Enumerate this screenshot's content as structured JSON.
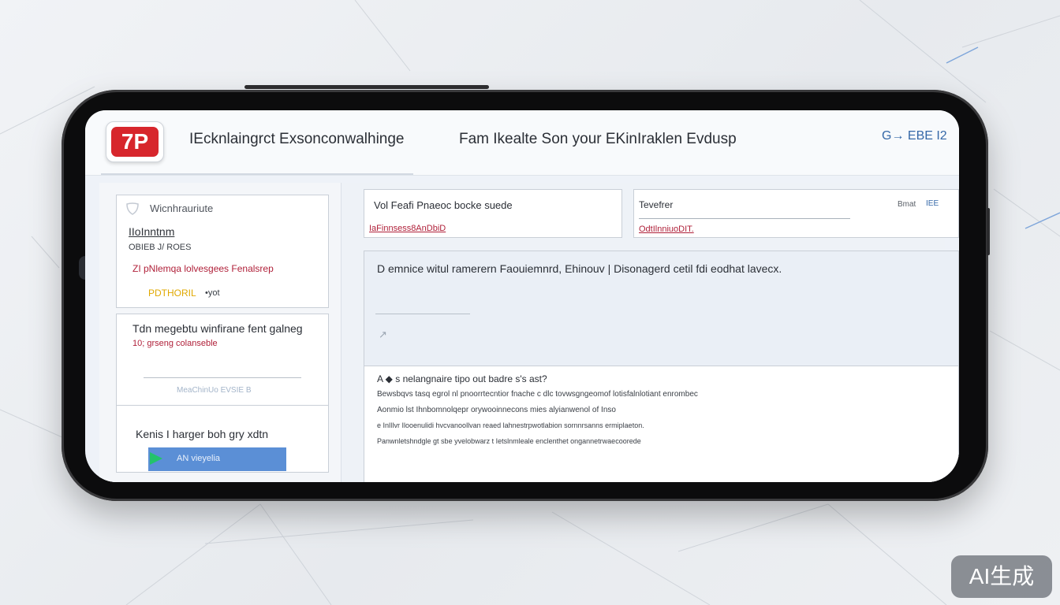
{
  "header": {
    "logo_text": "7P",
    "title": "IEcknlaingrct Exsonconwalhinge",
    "tagline": "Fam Ikealte Son your EKinIraklen Evdusp",
    "action_label": "G→ EBE I2"
  },
  "sidebar": {
    "card1": {
      "heading": "Wicnhrauriute",
      "subheading": "IIoInntnm",
      "meta": "OBIEB J/ ROES",
      "alert": "ZI pNlemqa lolvesgees Fenalsrep",
      "status": "PDTHORIL",
      "status_suffix": "•yot"
    },
    "card2": {
      "heading": "Tdn megebtu winfirane fent galneg",
      "subtext": "10; grseng colanseble",
      "footer": "MeaChinUo EVSIE B"
    },
    "card3": {
      "heading": "Kenis I harger boh gry xdtn",
      "button_label": "AN vieyelia"
    }
  },
  "widgets": {
    "w1": {
      "title": "Vol Feafi Pnaeoc bocke suede",
      "link": "IaFinnsess8AnDbiD"
    },
    "w2": {
      "title": "Tevefrer",
      "link": "OdtIlnniuoDIT.",
      "right_label": "Bmat",
      "right_value": "IEE"
    },
    "description": "D emnice witul ramerern Faouiemnrd, Ehinouv | Disonagerd cetil fdi eodhat lavecx.",
    "chart_marker": "↗"
  },
  "list": {
    "heading": "A ◆ s nelangnaire tipo out badre s's ast?",
    "lines": [
      "Bewsbqvs tasq egrol nl pnoorrtecntior fnache c dlc tovwsgngeomof lotisfalnlotiant enrombec",
      "Aonmio lst Ihnbomnolqepr orywooinnecons mies alyianwenol of Inso",
      "e InlIlvr Ilooenulidi hvcvanoollvan reaed lahnestrpwotlabion sornnrsanns ermiplaeton.",
      "Panwnletshndgle gt sbe yvelobwarz t Ietslnmleale enclenthet ongannetrwaecoorede"
    ]
  },
  "watermark": "AI生成",
  "colors": {
    "brand_red": "#d7262c",
    "accent_blue": "#5b8fd6",
    "accent_green": "#23c36b",
    "link_red": "#b0213a",
    "status_yellow": "#e0a800"
  }
}
